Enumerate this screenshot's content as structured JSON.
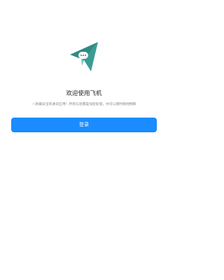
{
  "app": {
    "logo_icon": "paper-plane-chat-icon",
    "welcome_title": "欢迎使用飞机",
    "subtitle": "一款最安全的通讯应用！所有信息都是加密处理，你可以随时随地畅聊"
  },
  "login": {
    "button_label": "登录"
  },
  "colors": {
    "primary": "#1A8CFF",
    "logo_dark": "#2E8B85",
    "logo_light": "#6FC3B6",
    "background": "#FFFFFF"
  }
}
